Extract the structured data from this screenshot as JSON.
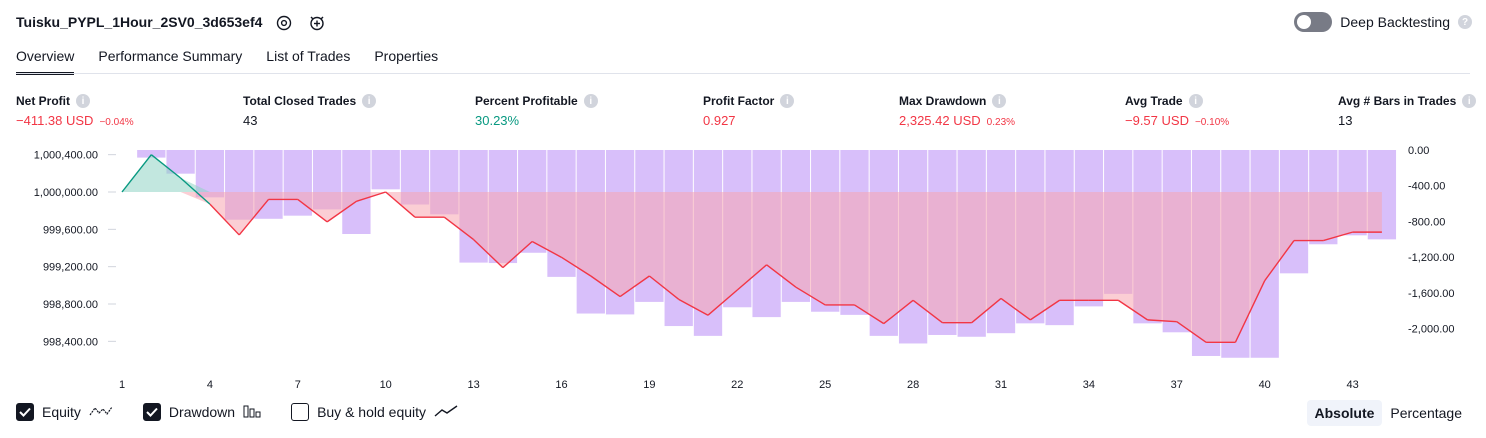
{
  "header": {
    "title": "Tuisku_PYPL_1Hour_2SV0_3d653ef4",
    "deep_backtesting_label": "Deep Backtesting",
    "deep_backtesting_on": false
  },
  "tabs": [
    {
      "label": "Overview",
      "active": true
    },
    {
      "label": "Performance Summary",
      "active": false
    },
    {
      "label": "List of Trades",
      "active": false
    },
    {
      "label": "Properties",
      "active": false
    }
  ],
  "metrics": [
    {
      "label": "Net Profit",
      "value": "−411.38 USD",
      "pct": "−0.04%",
      "tone": "neg"
    },
    {
      "label": "Total Closed Trades",
      "value": "43",
      "pct": "",
      "tone": "plain"
    },
    {
      "label": "Percent Profitable",
      "value": "30.23%",
      "pct": "",
      "tone": "pos"
    },
    {
      "label": "Profit Factor",
      "value": "0.927",
      "pct": "",
      "tone": "neg"
    },
    {
      "label": "Max Drawdown",
      "value": "2,325.42 USD",
      "pct": "0.23%",
      "tone": "neg"
    },
    {
      "label": "Avg Trade",
      "value": "−9.57 USD",
      "pct": "−0.10%",
      "tone": "neg"
    },
    {
      "label": "Avg # Bars in Trades",
      "value": "13",
      "pct": "",
      "tone": "plain"
    }
  ],
  "chart_data": {
    "type": "line",
    "x_ticks": [
      "1",
      "4",
      "7",
      "10",
      "13",
      "16",
      "19",
      "22",
      "25",
      "28",
      "31",
      "34",
      "37",
      "40",
      "43"
    ],
    "left_axis_ticks": [
      "1,000,400.00",
      "1,000,000.00",
      "999,600.00",
      "999,200.00",
      "998,800.00",
      "998,400.00"
    ],
    "right_axis_ticks": [
      "0.00",
      "-400.00",
      "-800.00",
      "-1,200.00",
      "-1,600.00",
      "-2,000.00"
    ],
    "equity_range": [
      998200,
      1000450
    ],
    "drawdown_range": [
      -2350,
      0
    ],
    "series": [
      {
        "name": "Equity",
        "color_up": "#089981",
        "color_down": "#f23645",
        "x": [
          1,
          2,
          3,
          4,
          5,
          6,
          7,
          8,
          9,
          10,
          11,
          12,
          13,
          14,
          15,
          16,
          17,
          18,
          19,
          20,
          21,
          22,
          23,
          24,
          25,
          26,
          27,
          28,
          29,
          30,
          31,
          32,
          33,
          34,
          35,
          36,
          37,
          38,
          39,
          40,
          41,
          42,
          43,
          44
        ],
        "values": [
          1000000,
          1000400,
          1000150,
          999870,
          999540,
          999920,
          999920,
          999680,
          999900,
          1000000,
          999730,
          999730,
          999490,
          999190,
          999470,
          999300,
          999100,
          998880,
          999100,
          998850,
          998680,
          998950,
          999220,
          998980,
          998790,
          998790,
          998590,
          998840,
          998600,
          998600,
          998860,
          998630,
          998840,
          998840,
          998840,
          998630,
          998610,
          998390,
          998390,
          999050,
          999480,
          999480,
          999570,
          999570
        ]
      },
      {
        "name": "Drawdown",
        "color": "#d1b4f9",
        "values": [
          0,
          -85,
          -265,
          -530,
          -780,
          -770,
          -735,
          -665,
          -940,
          -440,
          -610,
          -720,
          -1260,
          -1265,
          -1150,
          -1420,
          -1830,
          -1840,
          -1700,
          -1970,
          -2080,
          -1760,
          -1870,
          -1700,
          -1810,
          -1845,
          -2080,
          -2165,
          -2070,
          -2090,
          -2050,
          -1940,
          -1960,
          -1750,
          -1610,
          -1940,
          -2040,
          -2305,
          -2325,
          -2325,
          -1380,
          -1055,
          -955,
          -1000
        ]
      }
    ]
  },
  "legend": {
    "equity_label": "Equity",
    "drawdown_label": "Drawdown",
    "buyhold_label": "Buy & hold equity",
    "equity_checked": true,
    "drawdown_checked": true,
    "buyhold_checked": false
  },
  "mode": {
    "absolute_label": "Absolute",
    "percentage_label": "Percentage"
  }
}
